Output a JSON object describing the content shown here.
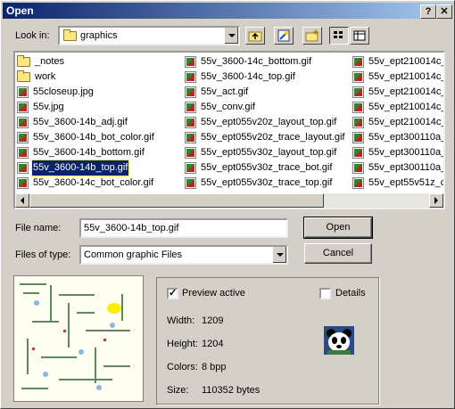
{
  "window": {
    "title": "Open",
    "help_glyph": "?",
    "close_glyph": "✕"
  },
  "lookin": {
    "label": "Look in:",
    "value": "graphics"
  },
  "toolbar": {
    "up_icon": "up-folder-icon",
    "favorites_icon": "favorites-icon",
    "newfolder_icon": "new-folder-icon",
    "list_icon": "list-view-icon",
    "details_icon": "details-view-icon"
  },
  "files": {
    "col1": [
      {
        "name": "_notes",
        "type": "folder"
      },
      {
        "name": "work",
        "type": "folder"
      },
      {
        "name": "55closeup.jpg",
        "type": "image"
      },
      {
        "name": "55v.jpg",
        "type": "image"
      },
      {
        "name": "55v_3600-14b_adj.gif",
        "type": "image"
      },
      {
        "name": "55v_3600-14b_bot_color.gif",
        "type": "image"
      },
      {
        "name": "55v_3600-14b_bottom.gif",
        "type": "image"
      },
      {
        "name": "55v_3600-14b_top.gif",
        "type": "image",
        "selected": true
      },
      {
        "name": "55v_3600-14c_bot_color.gif",
        "type": "image"
      }
    ],
    "col2": [
      {
        "name": "55v_3600-14c_bottom.gif",
        "type": "image"
      },
      {
        "name": "55v_3600-14c_top.gif",
        "type": "image"
      },
      {
        "name": "55v_act.gif",
        "type": "image"
      },
      {
        "name": "55v_conv.gif",
        "type": "image"
      },
      {
        "name": "55v_ept055v20z_layout_top.gif",
        "type": "image"
      },
      {
        "name": "55v_ept055v20z_trace_layout.gif",
        "type": "image"
      },
      {
        "name": "55v_ept055v30z_layout_top.gif",
        "type": "image"
      },
      {
        "name": "55v_ept055v30z_trace_bot.gif",
        "type": "image"
      },
      {
        "name": "55v_ept055v30z_trace_top.gif",
        "type": "image"
      }
    ],
    "col3": [
      {
        "name": "55v_ept210014c_",
        "type": "image"
      },
      {
        "name": "55v_ept210014c_",
        "type": "image"
      },
      {
        "name": "55v_ept210014c_",
        "type": "image"
      },
      {
        "name": "55v_ept210014c_",
        "type": "image"
      },
      {
        "name": "55v_ept210014c_",
        "type": "image"
      },
      {
        "name": "55v_ept300110a_",
        "type": "image"
      },
      {
        "name": "55v_ept300110a_",
        "type": "image"
      },
      {
        "name": "55v_ept300110a_",
        "type": "image"
      },
      {
        "name": "55v_ept55v51z_c",
        "type": "image"
      }
    ]
  },
  "filename": {
    "label": "File name:",
    "value": "55v_3600-14b_top.gif"
  },
  "filetype": {
    "label": "Files of type:",
    "value": "Common graphic Files"
  },
  "buttons": {
    "open": "Open",
    "cancel": "Cancel"
  },
  "preview": {
    "active_label": "Preview active",
    "active_checked": true,
    "details_label": "Details",
    "details_checked": false,
    "width_label": "Width:",
    "width_value": "1209",
    "height_label": "Height:",
    "height_value": "1204",
    "colors_label": "Colors:",
    "colors_value": "8 bpp",
    "size_label": "Size:",
    "size_value": "110352 bytes",
    "thumb_icon": "panda-icon"
  },
  "colors": {
    "title_start": "#0a246a",
    "title_end": "#a6caf0",
    "face": "#d4d0c8",
    "selection": "#0a246a"
  }
}
